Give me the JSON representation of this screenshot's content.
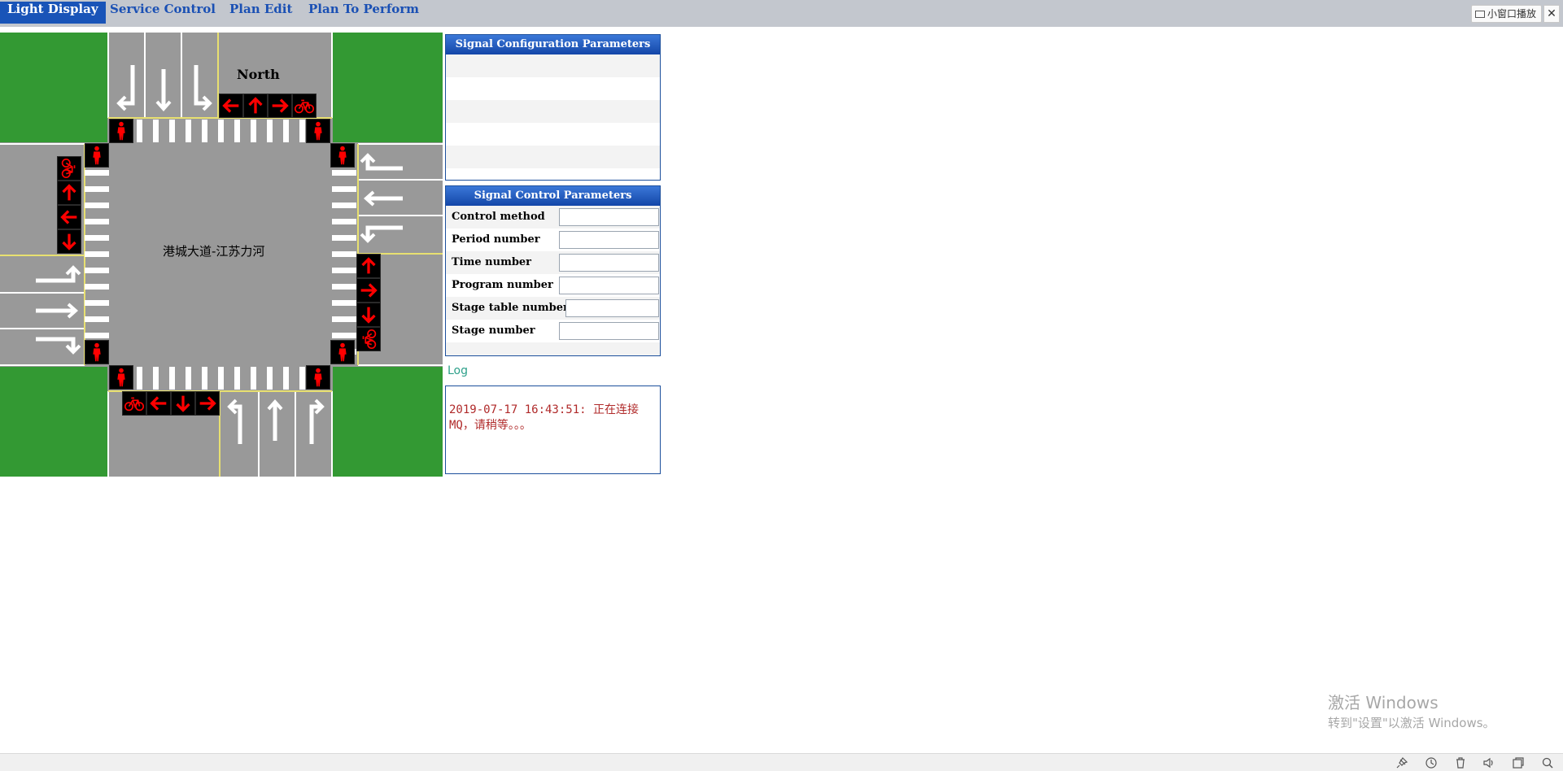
{
  "tabs": [
    {
      "label": "Light Display",
      "active": true
    },
    {
      "label": "Service Control",
      "active": false
    },
    {
      "label": "Plan Edit",
      "active": false
    },
    {
      "label": "Plan To Perform",
      "active": false
    }
  ],
  "pip": {
    "label": "小窗口播放",
    "close": "✕"
  },
  "intersection": {
    "north_label": "North",
    "name": "港城大道-江苏力河",
    "signal_color": "#ff0000",
    "road_color": "#999999",
    "grass_color": "#339933"
  },
  "config_panel": {
    "title": "Signal Configuration Parameters"
  },
  "control_panel": {
    "title": "Signal Control Parameters",
    "fields": [
      {
        "label": "Control method",
        "value": ""
      },
      {
        "label": "Period number",
        "value": ""
      },
      {
        "label": "Time number",
        "value": ""
      },
      {
        "label": "Program number",
        "value": ""
      },
      {
        "label": "Stage table number",
        "value": ""
      },
      {
        "label": "Stage number",
        "value": ""
      }
    ]
  },
  "log": {
    "title": "Log",
    "lines": [
      "2019-07-17 16:43:51: 正在连接",
      "MQ，请稍等。。。"
    ]
  },
  "watermark": {
    "line1": "激活 Windows",
    "line2": "转到\"设置\"以激活 Windows。"
  },
  "statusbar": {
    "icons": [
      "pin-icon",
      "history-icon",
      "trash-icon",
      "volume-icon",
      "window-icon",
      "search-icon"
    ]
  }
}
